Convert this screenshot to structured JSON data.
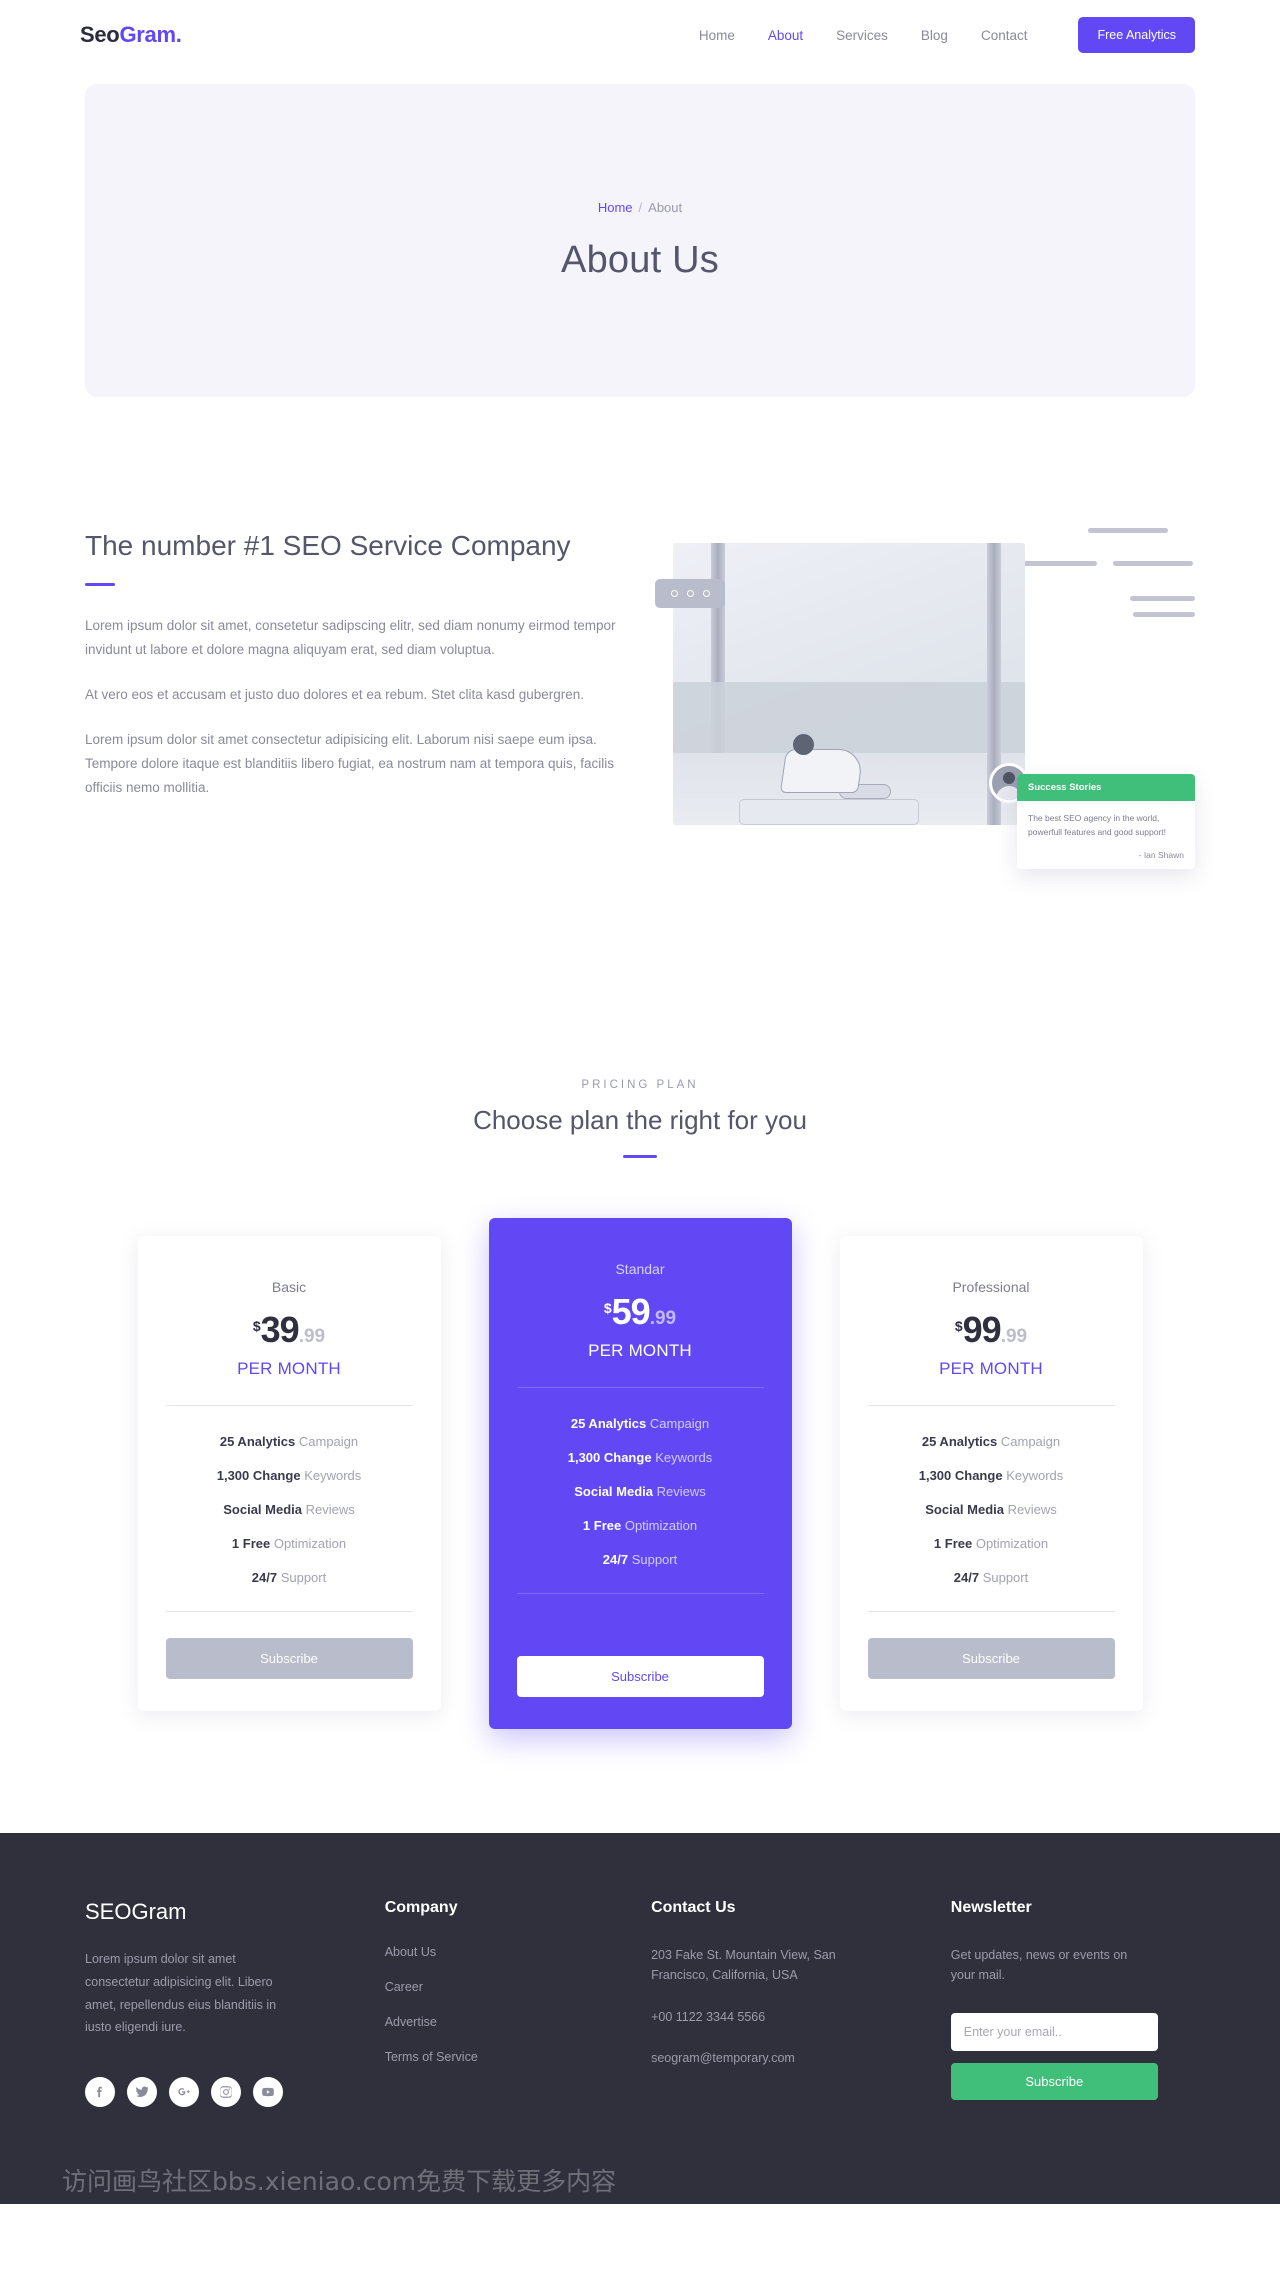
{
  "header": {
    "logo_main": "Seo",
    "logo_accent": "Gram.",
    "nav": [
      {
        "label": "Home",
        "active": false
      },
      {
        "label": "About",
        "active": true
      },
      {
        "label": "Services",
        "active": false
      },
      {
        "label": "Blog",
        "active": false
      },
      {
        "label": "Contact",
        "active": false
      }
    ],
    "cta_label": "Free Analytics",
    "accent_color": "#6248f5"
  },
  "banner": {
    "breadcrumb_home": "Home",
    "breadcrumb_sep": "/",
    "breadcrumb_current": "About",
    "title": "About Us",
    "bg_color": "#f4f4fa"
  },
  "about": {
    "heading": "The number #1 SEO Service Company",
    "paragraph1": "Lorem ipsum dolor sit amet, consetetur sadipscing elitr, sed diam nonumy eirmod tempor invidunt ut labore et dolore magna aliquyam erat, sed diam voluptua.",
    "paragraph2": "At vero eos et accusam et justo duo dolores et ea rebum. Stet clita kasd gubergren.",
    "paragraph3": "Lorem ipsum dolor sit amet consectetur adipisicing elit. Laborum nisi saepe eum ipsa. Tempore dolore itaque est blanditiis libero fugiat, ea nostrum nam at tempora quis, facilis officiis nemo mollitia.",
    "story": {
      "title": "Success Stories",
      "text": "The best SEO agency in the world, powerfull features and good support!",
      "author": "- Ian Shawn",
      "header_color": "#3fbf79"
    }
  },
  "pricing": {
    "kicker": "PRICING PLAN",
    "title": "Choose plan the right for you",
    "plans": [
      {
        "name": "Basic",
        "currency": "$",
        "amount": "39",
        "cents": ".99",
        "period": "PER MONTH",
        "featured": false,
        "features": [
          {
            "bold": "25 Analytics",
            "light": "Campaign"
          },
          {
            "bold": "1,300 Change",
            "light": "Keywords"
          },
          {
            "bold": "Social Media",
            "light": "Reviews"
          },
          {
            "bold": "1 Free",
            "light": "Optimization"
          },
          {
            "bold": "24/7",
            "light": "Support"
          }
        ],
        "cta": "Subscribe"
      },
      {
        "name": "Standar",
        "currency": "$",
        "amount": "59",
        "cents": ".99",
        "period": "PER MONTH",
        "featured": true,
        "features": [
          {
            "bold": "25 Analytics",
            "light": "Campaign"
          },
          {
            "bold": "1,300 Change",
            "light": "Keywords"
          },
          {
            "bold": "Social Media",
            "light": "Reviews"
          },
          {
            "bold": "1 Free",
            "light": "Optimization"
          },
          {
            "bold": "24/7",
            "light": "Support"
          }
        ],
        "cta": "Subscribe"
      },
      {
        "name": "Professional",
        "currency": "$",
        "amount": "99",
        "cents": ".99",
        "period": "PER MONTH",
        "featured": false,
        "features": [
          {
            "bold": "25 Analytics",
            "light": "Campaign"
          },
          {
            "bold": "1,300 Change",
            "light": "Keywords"
          },
          {
            "bold": "Social Media",
            "light": "Reviews"
          },
          {
            "bold": "1 Free",
            "light": "Optimization"
          },
          {
            "bold": "24/7",
            "light": "Support"
          }
        ],
        "cta": "Subscribe"
      }
    ]
  },
  "footer": {
    "brand": "SEOGram",
    "about_text": "Lorem ipsum dolor sit amet consectetur adipisicing elit. Libero amet, repellendus eius blanditiis in iusto eligendi iure.",
    "company": {
      "heading": "Company",
      "links": [
        "About Us",
        "Career",
        "Advertise",
        "Terms of Service"
      ]
    },
    "contact": {
      "heading": "Contact Us",
      "address": "203 Fake St. Mountain View, San Francisco, California, USA",
      "phone": "+00 1122 3344 5566",
      "email": "seogram@temporary.com"
    },
    "newsletter": {
      "heading": "Newsletter",
      "text": "Get updates, news or events on your mail.",
      "placeholder": "Enter your email..",
      "button": "Subscribe",
      "button_color": "#3fbf79"
    },
    "socials": [
      "facebook-icon",
      "twitter-icon",
      "google-plus-icon",
      "instagram-icon",
      "youtube-icon"
    ],
    "watermark": "访问画鸟社区bbs.xieniao.com免费下载更多内容",
    "bg_color": "#30303d"
  }
}
